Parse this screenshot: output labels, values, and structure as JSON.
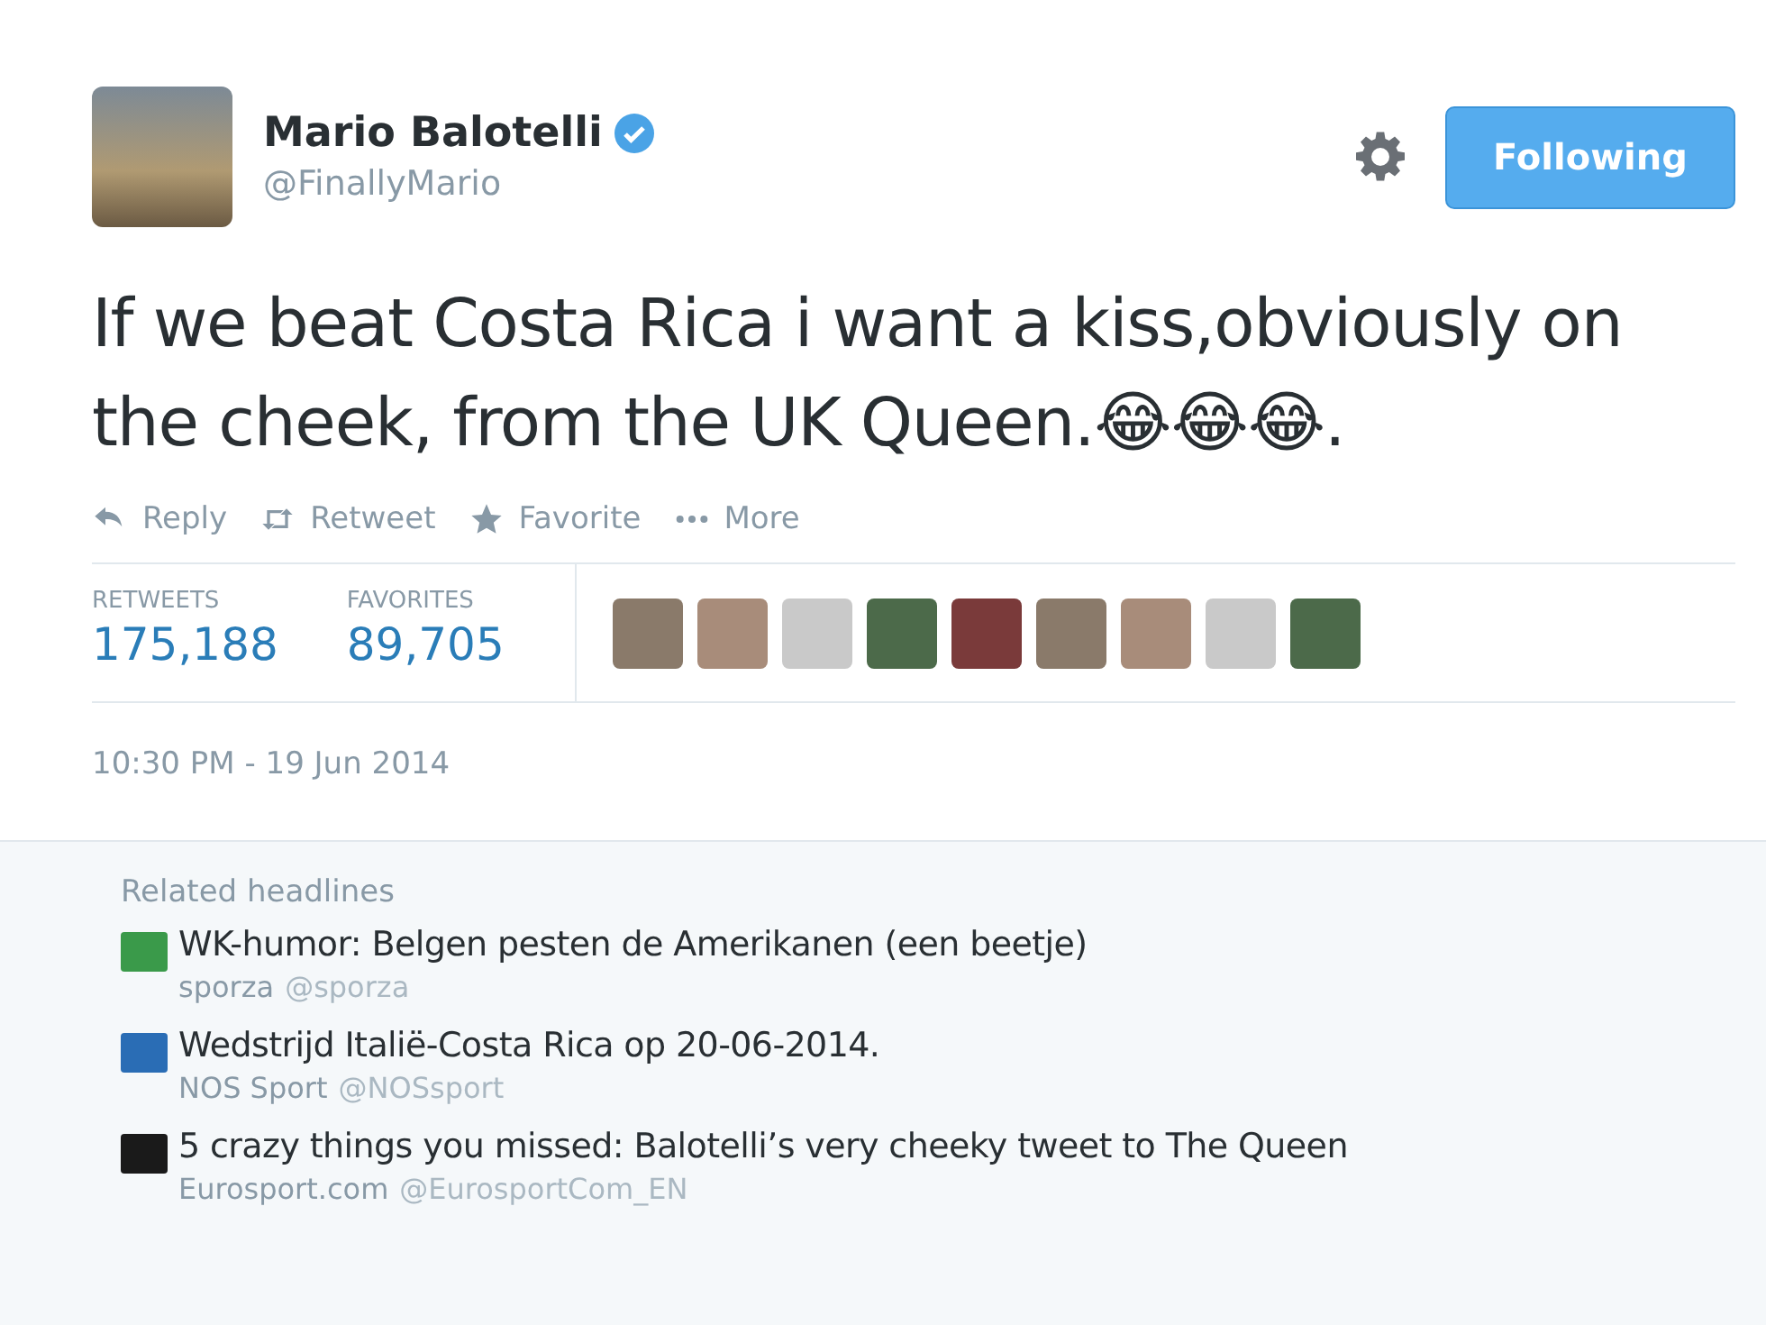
{
  "author": {
    "name": "Mario Balotelli",
    "handle": "@FinallyMario",
    "verified": true
  },
  "follow_button": {
    "label": "Following",
    "following": true
  },
  "tweet": {
    "text": "If we beat Costa Rica i want a kiss,obviously on the cheek, from the UK Queen.😂😂😂."
  },
  "actions": [
    {
      "kind": "reply",
      "label": "Reply"
    },
    {
      "kind": "retweet",
      "label": "Retweet"
    },
    {
      "kind": "favorite",
      "label": "Favorite"
    },
    {
      "kind": "more",
      "label": "More"
    }
  ],
  "stats": [
    {
      "label": "RETWEETS",
      "value": "175,188"
    },
    {
      "label": "FAVORITES",
      "value": "89,705"
    }
  ],
  "favoriter_avatars": [
    {
      "kind": "photo"
    },
    {
      "kind": "photo"
    },
    {
      "kind": "photo"
    },
    {
      "kind": "photo"
    },
    {
      "kind": "photo"
    },
    {
      "kind": "photo"
    },
    {
      "kind": "photo"
    },
    {
      "kind": "photo"
    },
    {
      "kind": "photo"
    }
  ],
  "timestamp": "10:30 PM - 19 Jun 2014",
  "related": {
    "title": "Related headlines",
    "items": [
      {
        "headline": "WK-humor: Belgen pesten de Amerikanen (een beetje)",
        "source": "sporza",
        "handle": "@sporza",
        "color": "#3a9a4a"
      },
      {
        "headline": "Wedstrijd Italië-Costa Rica op 20-06-2014.",
        "source": "NOS Sport",
        "handle": "@NOSsport",
        "color": "#2a6db5"
      },
      {
        "headline": "5 crazy things you missed: Balotelli’s very cheeky tweet to The Queen",
        "source": "Eurosport.com",
        "handle": "@EurosportCom_EN",
        "color": "#1a1a1a"
      }
    ]
  }
}
